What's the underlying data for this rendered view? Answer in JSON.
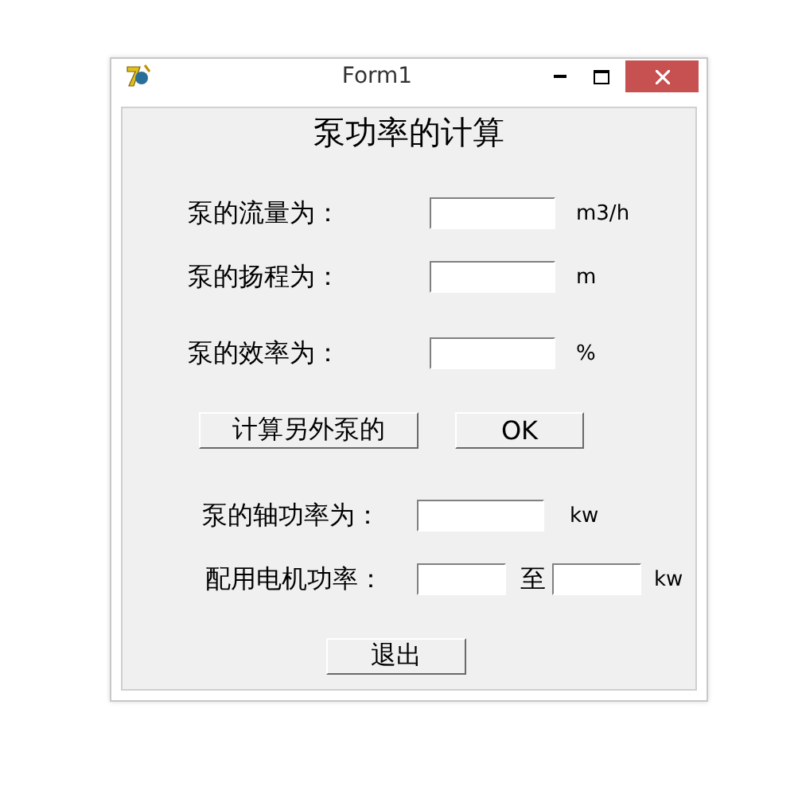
{
  "window": {
    "title": "Form1"
  },
  "heading": "泵功率的计算",
  "inputs": [
    {
      "label": "泵的流量为：",
      "unit": "m3/h"
    },
    {
      "label": "泵的扬程为：",
      "unit": "m"
    },
    {
      "label": "泵的效率为：",
      "unit": "%"
    }
  ],
  "buttons": [
    "计算另外泵的",
    "OK"
  ],
  "results": [
    {
      "label": "泵的轴功率为：",
      "unit": "kw"
    },
    {
      "label": "配用电机功率：",
      "separator": "至",
      "unit": "kw"
    }
  ],
  "exit_button": "退出"
}
